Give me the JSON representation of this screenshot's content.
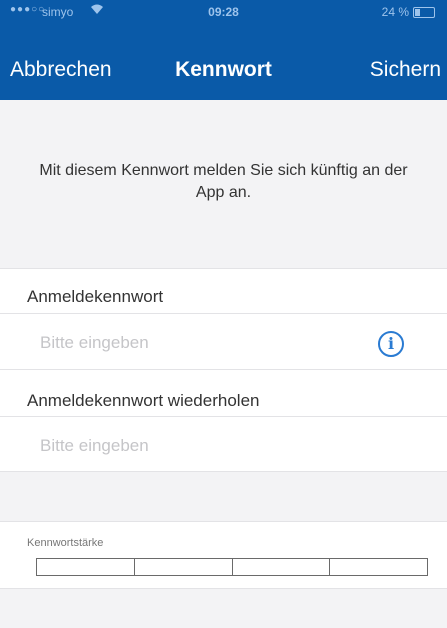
{
  "status_bar": {
    "signal": "●●●○○",
    "carrier": "simyo",
    "wifi_icon": "wifi-icon",
    "time": "09:28",
    "battery": "24 %",
    "battery_level": 0.24
  },
  "nav": {
    "cancel_label": "Abbrechen",
    "title": "Kennwort",
    "save_label": "Sichern"
  },
  "info_message": "Mit diesem Kennwort melden Sie sich künftig an der App an.",
  "password_field": {
    "label": "Anmeldekennwort",
    "placeholder": "Bitte eingeben",
    "info_icon": "info-icon",
    "info_glyph": "i"
  },
  "repeat_field": {
    "label": "Anmeldekennwort wiederholen",
    "placeholder": "Bitte eingeben"
  },
  "strength": {
    "label": "Kennwortstärke",
    "segments": 4,
    "level": 0
  },
  "colors": {
    "header": "#0a5aa8",
    "accent": "#2a7bd2"
  }
}
